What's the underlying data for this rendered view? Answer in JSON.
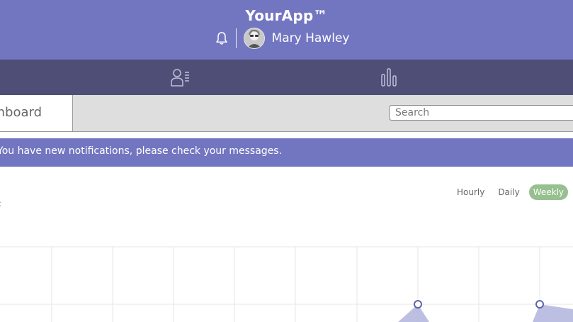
{
  "app": {
    "title": "YourApp™"
  },
  "user": {
    "name": "Mary Hawley",
    "avatar_icon": "user-avatar-photo",
    "notification_icon": "bell-icon"
  },
  "nav": {
    "items": [
      {
        "icon": "user-list-icon"
      },
      {
        "icon": "bar-chart-icon"
      }
    ]
  },
  "tabs": {
    "active_label": "Dashboard"
  },
  "search": {
    "placeholder": "Search",
    "value": ""
  },
  "notice": {
    "text": "You have new notifications, please check your messages."
  },
  "range": {
    "options": [
      "Hourly",
      "Daily",
      "Weekly"
    ],
    "selected": "Weekly"
  },
  "colors": {
    "header": "#7276c1",
    "navbar": "#4e4e76",
    "tabbar": "#dedede",
    "selected_range": "#96c08f",
    "chart_fill": "#b6b8df",
    "chart_point": "#5f62b0"
  }
}
